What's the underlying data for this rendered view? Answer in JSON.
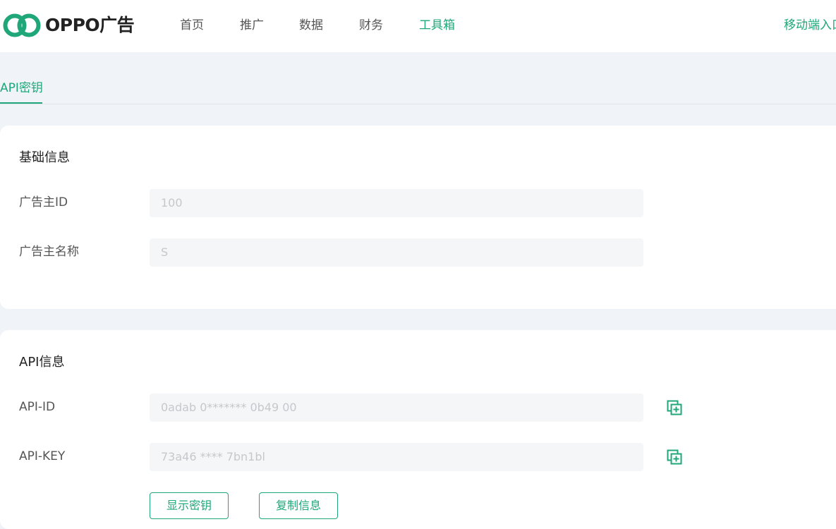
{
  "brand": {
    "name": "OPPO广告",
    "accent_color": "#1fa77a"
  },
  "nav": {
    "items": [
      {
        "label": "首页",
        "active": false
      },
      {
        "label": "推广",
        "active": false
      },
      {
        "label": "数据",
        "active": false
      },
      {
        "label": "财务",
        "active": false
      },
      {
        "label": "工具箱",
        "active": true
      }
    ],
    "mobile_link": "移动端入口"
  },
  "tabs": [
    {
      "label": "API密钥",
      "active": true
    }
  ],
  "basic_info": {
    "title": "基础信息",
    "advertiser_id_label": "广告主ID",
    "advertiser_id_value": "100",
    "advertiser_name_label": "广告主名称",
    "advertiser_name_value": "S"
  },
  "api_info": {
    "title": "API信息",
    "api_id_label": "API-ID",
    "api_id_value": "0adab  0*******  0b49     00",
    "api_id_copy_icon": "copy-icon",
    "api_key_label": "API-KEY",
    "api_key_value": "73a46     ****     7bn1bl",
    "api_key_copy_icon": "copy-icon",
    "show_key_button": "显示密钥",
    "copy_info_button": "复制信息"
  }
}
